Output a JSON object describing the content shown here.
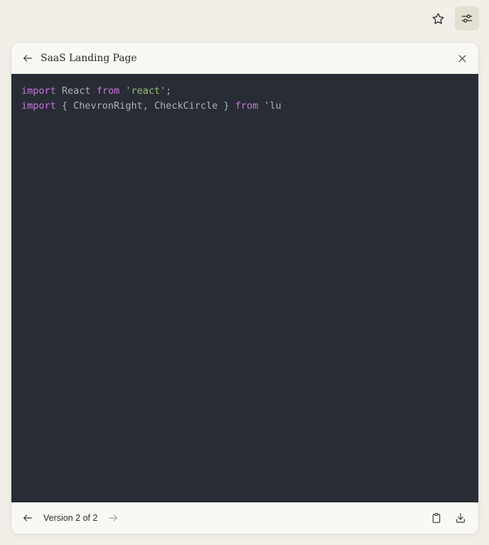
{
  "top_actions": {
    "star_icon": "star-icon",
    "settings_icon": "sliders-icon"
  },
  "artifact": {
    "title": "SaaS Landing Page",
    "code_lines": [
      [
        {
          "t": "import",
          "c": "kw"
        },
        {
          "t": " React ",
          "c": "plain"
        },
        {
          "t": "from",
          "c": "kw"
        },
        {
          "t": " ",
          "c": "plain"
        },
        {
          "t": "'react'",
          "c": "str"
        },
        {
          "t": ";",
          "c": "plain"
        }
      ],
      [
        {
          "t": "import",
          "c": "kw"
        },
        {
          "t": " { ChevronRight, CheckCircle } ",
          "c": "plain"
        },
        {
          "t": "from",
          "c": "kw"
        },
        {
          "t": " 'lu",
          "c": "plain"
        }
      ]
    ],
    "footer": {
      "version_label": "Version 2 of 2"
    }
  },
  "colors": {
    "background": "#f1efe8",
    "code_background": "#282c34",
    "keyword": "#c678dd",
    "string": "#98c379",
    "plain": "#abb2bf"
  }
}
